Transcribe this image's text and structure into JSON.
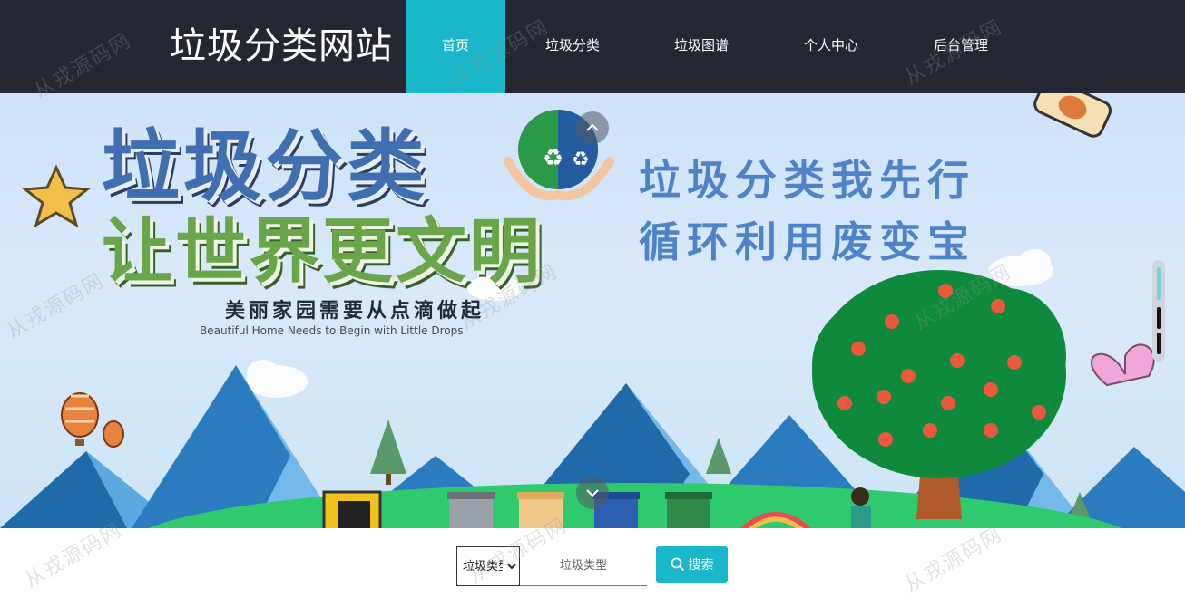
{
  "header": {
    "site_title": "垃圾分类网站",
    "nav": [
      {
        "label": "首页",
        "active": true
      },
      {
        "label": "垃圾分类",
        "active": false
      },
      {
        "label": "垃圾图谱",
        "active": false
      },
      {
        "label": "个人中心",
        "active": false
      },
      {
        "label": "后台管理",
        "active": false
      }
    ]
  },
  "banner": {
    "title_line1": "垃圾分类",
    "title_line2": "让世界更文明",
    "tagline": "美丽家园需要从点滴做起",
    "tagline_en": "Beautiful Home Needs to Begin with Little Drops",
    "slogan_line1": "垃圾分类我先行",
    "slogan_line2": "循环利用废变宝",
    "prev_icon": "chevron-up-icon",
    "next_icon": "chevron-down-icon"
  },
  "search": {
    "select_value": "垃圾类型",
    "select_options": [
      "垃圾类型"
    ],
    "input_placeholder": "垃圾类型",
    "button_label": "搜索",
    "button_icon": "search-icon"
  },
  "watermark": {
    "text": "从戎源码网"
  },
  "colors": {
    "header_bg": "#242732",
    "accent": "#1ab6c9"
  }
}
